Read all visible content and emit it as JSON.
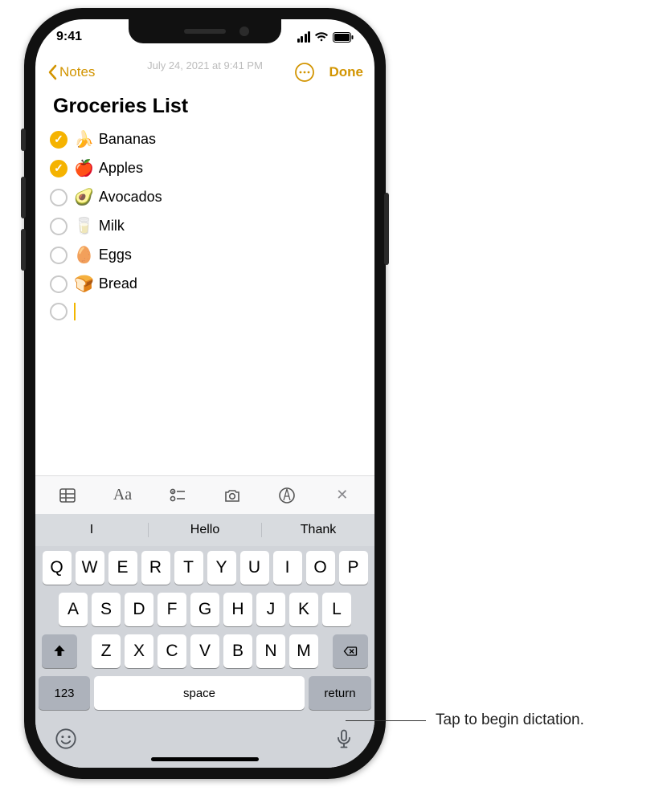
{
  "status": {
    "time": "9:41"
  },
  "nav": {
    "back_label": "Notes",
    "done_label": "Done",
    "timestamp": "July 24, 2021 at 9:41 PM"
  },
  "note": {
    "title": "Groceries List",
    "items": [
      {
        "checked": true,
        "emoji": "🍌",
        "label": "Bananas"
      },
      {
        "checked": true,
        "emoji": "🍎",
        "label": "Apples"
      },
      {
        "checked": false,
        "emoji": "🥑",
        "label": "Avocados"
      },
      {
        "checked": false,
        "emoji": "🥛",
        "label": "Milk"
      },
      {
        "checked": false,
        "emoji": "🥚",
        "label": "Eggs"
      },
      {
        "checked": false,
        "emoji": "🍞",
        "label": "Bread"
      }
    ]
  },
  "toolbar": {
    "table": "table-icon",
    "format": "Aa",
    "checklist": "checklist-icon",
    "camera": "camera-icon",
    "draw": "markup-icon",
    "close": "✕"
  },
  "keyboard": {
    "suggestions": [
      "I",
      "Hello",
      "Thank"
    ],
    "row1": [
      "Q",
      "W",
      "E",
      "R",
      "T",
      "Y",
      "U",
      "I",
      "O",
      "P"
    ],
    "row2": [
      "A",
      "S",
      "D",
      "F",
      "G",
      "H",
      "J",
      "K",
      "L"
    ],
    "row3": [
      "Z",
      "X",
      "C",
      "V",
      "B",
      "N",
      "M"
    ],
    "num_key": "123",
    "space_key": "space",
    "return_key": "return"
  },
  "callout": {
    "text": "Tap to begin dictation."
  }
}
